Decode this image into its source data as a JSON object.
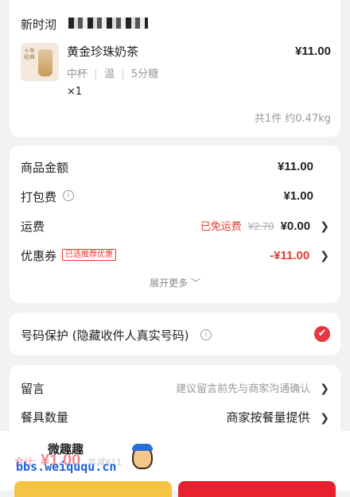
{
  "store": {
    "name": "新时沏"
  },
  "item": {
    "name": "黄金珍珠奶茶",
    "price": "¥11.00",
    "spec_size": "中杯",
    "spec_temp": "温",
    "spec_sugar": "5分糖",
    "qty": "×1",
    "summary": "共1件 约0.47kg",
    "thumb_text": "十年经典"
  },
  "costs": {
    "goods_label": "商品金额",
    "goods_value": "¥11.00",
    "pack_label": "打包费",
    "pack_value": "¥1.00",
    "ship_label": "运费",
    "ship_free": "已免运费",
    "ship_original": "¥2.70",
    "ship_value": "¥0.00",
    "coupon_label": "优惠券",
    "coupon_tag": "已选推荐优惠",
    "coupon_value": "-¥11.00",
    "expand": "展开更多"
  },
  "privacy": {
    "label": "号码保护 (隐藏收件人真实号码)",
    "checked": true
  },
  "notes": {
    "message_label": "留言",
    "message_hint": "建议留言前先与商家沟通确认",
    "tableware_label": "餐具数量",
    "tableware_value": "商家按餐量提供"
  },
  "footer": {
    "total_label": "合计:",
    "total_value": "¥1.00",
    "saved": "共减¥11",
    "watermark_title": "微趣趣",
    "watermark_url": "bbs.weiququ.cn"
  },
  "colors": {
    "accent": "#e8212f",
    "coupon_red": "#e33b2e",
    "checkbox": "#e8373e",
    "yellow_button": "#f6c343"
  }
}
